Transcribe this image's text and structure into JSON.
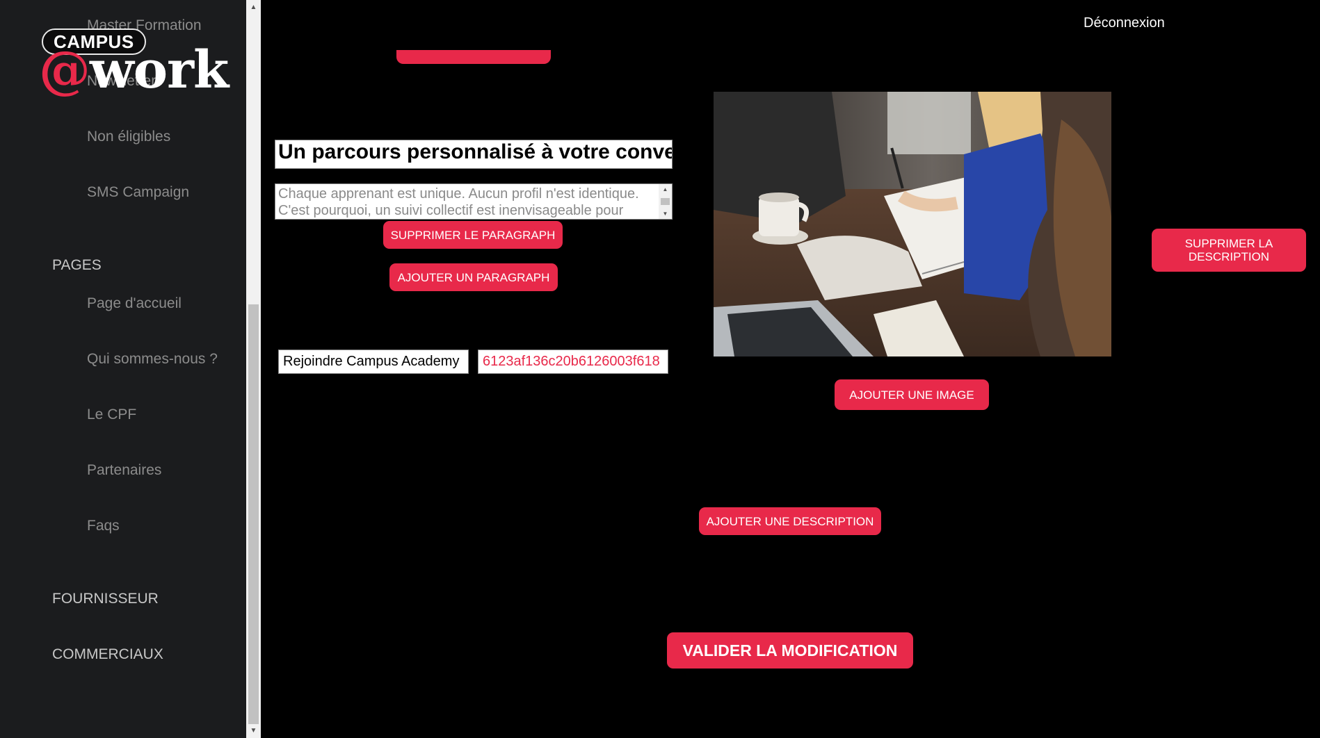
{
  "brand": {
    "campus": "CAMPUS",
    "at": "@",
    "work": "work"
  },
  "sidebar": {
    "items_top": [
      "Master Formation",
      "Newsletter",
      "Non éligibles",
      "SMS Campaign"
    ],
    "pages_heading": "PAGES",
    "pages": [
      "Page d'accueil",
      "Qui sommes-nous ?",
      "Le CPF",
      "Partenaires",
      "Faqs"
    ],
    "sections": [
      "FOURNISSEUR",
      "COMMERCIAUX"
    ]
  },
  "header": {
    "logout": "Déconnexion"
  },
  "editor": {
    "title_value": "Un parcours personnalisé à votre convenance",
    "paragraph_text": "Chaque apprenant est unique. Aucun profil n'est identique. C'est pourquoi, un suivi collectif est inenvisageable pour",
    "delete_paragraph": "SUPPRIMER LE PARAGRAPH",
    "add_paragraph": "AJOUTER UN PARAGRAPH",
    "link_label": "Rejoindre Campus Academy",
    "link_id": "6123af136c20b6126003f618",
    "add_image": "AJOUTER UNE IMAGE",
    "delete_description": "SUPPRIMER LA DESCRIPTION",
    "add_description": "AJOUTER UNE DESCRIPTION",
    "validate": "VALIDER LA MODIFICATION"
  },
  "colors": {
    "accent": "#e8294a",
    "sidebar_bg": "#1b1c1e",
    "main_bg": "#000000"
  }
}
